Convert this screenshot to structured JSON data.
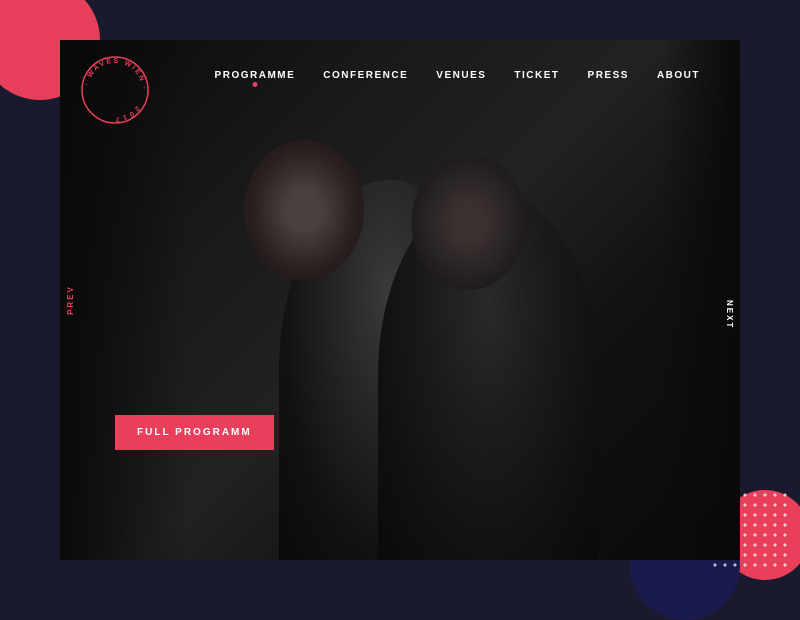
{
  "brand": {
    "name": "WAVES WIEN",
    "year": "2017",
    "logo_label": "WAVES WIEN 2017"
  },
  "nav": {
    "items": [
      {
        "label": "PROGRAMME",
        "active": true
      },
      {
        "label": "CONFERENCE",
        "active": false
      },
      {
        "label": "VENUES",
        "active": false
      },
      {
        "label": "TICKET",
        "active": false
      },
      {
        "label": "PRESS",
        "active": false
      },
      {
        "label": "ABOUT",
        "active": false
      }
    ]
  },
  "hero": {
    "prev_label": "PREV",
    "next_label": "NEXT",
    "cta_label": "FULL PROGRAMM"
  },
  "colors": {
    "accent": "#e8405a",
    "bg_dark": "#0a0a0a",
    "bg_outer": "#1a1a2e",
    "text_white": "#ffffff"
  }
}
